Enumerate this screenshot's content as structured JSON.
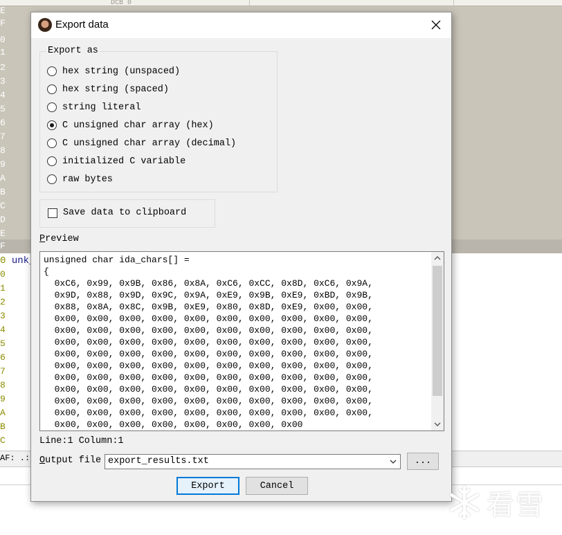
{
  "background": {
    "gutter_light": [
      "E",
      "F",
      "0",
      "1",
      "2",
      "3",
      "4",
      "5",
      "6",
      "7",
      "8",
      "9",
      "A",
      "B",
      "C",
      "D",
      "E",
      "F"
    ],
    "gutter_olive": [
      "0",
      "0",
      "1",
      "2",
      "3",
      "4",
      "5",
      "6",
      "7",
      "8",
      "9",
      "A",
      "B",
      "C"
    ],
    "unk_label": "unk_",
    "unk_num": "0",
    "status_text": "AF: .:",
    "faint_text": "DCB     0"
  },
  "dialog": {
    "title": "Export data",
    "export_as_label": "Export as",
    "options": [
      {
        "label": "hex string (unspaced)",
        "checked": false
      },
      {
        "label": "hex string (spaced)",
        "checked": false
      },
      {
        "label": "string literal",
        "checked": false
      },
      {
        "label": "C unsigned char array (hex)",
        "checked": true
      },
      {
        "label": "C unsigned char array (decimal)",
        "checked": false
      },
      {
        "label": "initialized C variable",
        "checked": false
      },
      {
        "label": "raw bytes",
        "checked": false
      }
    ],
    "clipboard_label": "Save data to clipboard",
    "preview_label_first": "P",
    "preview_label_rest": "review",
    "preview_lines": [
      "unsigned char ida_chars[] =",
      "{",
      "  0xC6, 0x99, 0x9B, 0x86, 0x8A, 0xC6, 0xCC, 0x8D, 0xC6, 0x9A,",
      "  0x9D, 0x88, 0x9D, 0x9C, 0x9A, 0xE9, 0x9B, 0xE9, 0xBD, 0x9B,",
      "  0x88, 0x8A, 0x8C, 0x9B, 0xE9, 0x80, 0x8D, 0xE9, 0x00, 0x00,",
      "  0x00, 0x00, 0x00, 0x00, 0x00, 0x00, 0x00, 0x00, 0x00, 0x00,",
      "  0x00, 0x00, 0x00, 0x00, 0x00, 0x00, 0x00, 0x00, 0x00, 0x00,",
      "  0x00, 0x00, 0x00, 0x00, 0x00, 0x00, 0x00, 0x00, 0x00, 0x00,",
      "  0x00, 0x00, 0x00, 0x00, 0x00, 0x00, 0x00, 0x00, 0x00, 0x00,",
      "  0x00, 0x00, 0x00, 0x00, 0x00, 0x00, 0x00, 0x00, 0x00, 0x00,",
      "  0x00, 0x00, 0x00, 0x00, 0x00, 0x00, 0x00, 0x00, 0x00, 0x00,",
      "  0x00, 0x00, 0x00, 0x00, 0x00, 0x00, 0x00, 0x00, 0x00, 0x00,",
      "  0x00, 0x00, 0x00, 0x00, 0x00, 0x00, 0x00, 0x00, 0x00, 0x00,",
      "  0x00, 0x00, 0x00, 0x00, 0x00, 0x00, 0x00, 0x00, 0x00, 0x00,",
      "  0x00, 0x00, 0x00, 0x00, 0x00, 0x00, 0x00, 0x00"
    ],
    "line_col": "Line:1  Column:1",
    "output_label_first": "O",
    "output_label_rest": "utput file",
    "output_value": "export_results.txt",
    "browse_label": "...",
    "export_button": "Export",
    "cancel_button": "Cancel"
  },
  "watermark": "看雪",
  "colors": {
    "bg_gray": "#c9c5b9",
    "dialog_bg": "#f0f0f0",
    "accent_focus": "#0078d7",
    "olive_text": "#8b8b00",
    "name_text": "#1a1a8a"
  },
  "icons": {
    "close": "close-icon",
    "scroll_up": "chevron-up-icon",
    "scroll_down": "chevron-down-icon",
    "dropdown": "chevron-down-icon",
    "title": "app-icon",
    "watermark": "snowflake-icon"
  }
}
